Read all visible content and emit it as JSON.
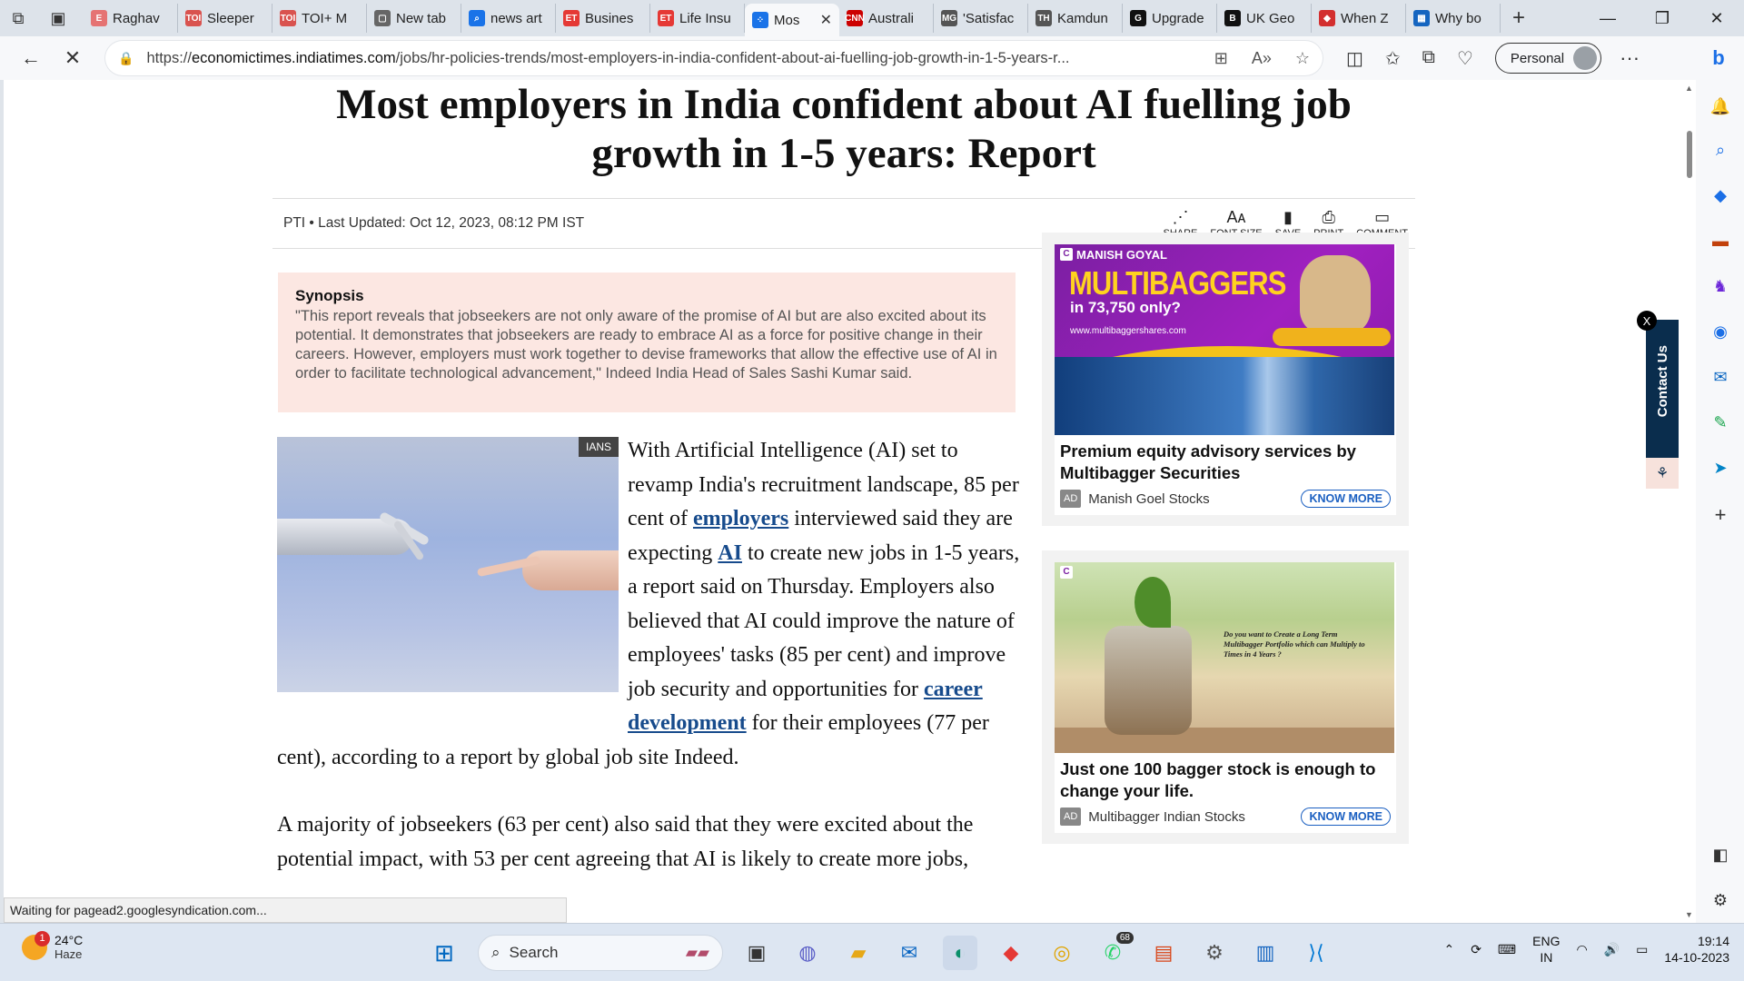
{
  "browser": {
    "tabs": [
      {
        "label": "Raghav",
        "favicon_color": "#e57373",
        "favicon_text": "E"
      },
      {
        "label": "Sleeper",
        "favicon_color": "#d9534f",
        "favicon_text": "TOI"
      },
      {
        "label": "TOI+ M",
        "favicon_color": "#d9534f",
        "favicon_text": "TOI"
      },
      {
        "label": "New tab",
        "favicon_color": "#666",
        "favicon_text": "▢"
      },
      {
        "label": "news art",
        "favicon_color": "#1a73e8",
        "favicon_text": "⌕"
      },
      {
        "label": "Busines",
        "favicon_color": "#e53935",
        "favicon_text": "ET"
      },
      {
        "label": "Life Insu",
        "favicon_color": "#e53935",
        "favicon_text": "ET"
      },
      {
        "label": "Mos",
        "favicon_color": "#1a73e8",
        "favicon_text": "⁘",
        "active": true
      },
      {
        "label": "Australi",
        "favicon_color": "#cc0000",
        "favicon_text": "CNN"
      },
      {
        "label": "'Satisfac",
        "favicon_color": "#555",
        "favicon_text": "MG"
      },
      {
        "label": "Kamdun",
        "favicon_color": "#555",
        "favicon_text": "TH"
      },
      {
        "label": "Upgrade",
        "favicon_color": "#111",
        "favicon_text": "G"
      },
      {
        "label": "UK Geo",
        "favicon_color": "#111",
        "favicon_text": "B"
      },
      {
        "label": "When Z",
        "favicon_color": "#d32f2f",
        "favicon_text": "◆"
      },
      {
        "label": "Why bo",
        "favicon_color": "#1565c0",
        "favicon_text": "▦"
      }
    ],
    "url_prefix": "https://",
    "url_domain": "economictimes.indiatimes.com",
    "url_path": "/jobs/hr-policies-trends/most-employers-in-india-confident-about-ai-fuelling-job-growth-in-1-5-years-r...",
    "profile_label": "Personal",
    "status_text": "Waiting for pagead2.googlesyndication.com..."
  },
  "article": {
    "headline": "Most employers in India confident about AI fuelling job growth in 1-5 years: Report",
    "byline_source": "PTI",
    "byline_updated": "Last Updated: Oct 12, 2023, 08:12 PM IST",
    "actions": [
      {
        "label": "SHARE",
        "icon": "share-icon"
      },
      {
        "label": "FONT SIZE",
        "icon": "font-size-icon"
      },
      {
        "label": "SAVE",
        "icon": "bookmark-icon"
      },
      {
        "label": "PRINT",
        "icon": "print-icon"
      },
      {
        "label": "COMMENT",
        "icon": "comment-icon"
      }
    ],
    "synopsis_title": "Synopsis",
    "synopsis_text": "\"This report reveals that jobseekers are not only aware of the promise of AI but are also excited about its potential. It demonstrates that jobseekers are ready to embrace AI as a force for positive change in their careers. However, employers must work together to devise frameworks that allow the effective use of AI in order to facilitate technological advancement,\" Indeed India Head of Sales Sashi Kumar said.",
    "image_credit": "IANS",
    "p1": {
      "t1": "With Artificial Intelligence (AI) set to revamp India's recruitment landscape, 85 per cent of ",
      "link1": "employers",
      "t2": " interviewed said they are expecting ",
      "link2": "AI",
      "t3": " to create new jobs in 1-5 years, a report said on Thursday. Employers also believed that AI could improve the nature of employees' tasks (85 per cent) and improve job security and opportunities for ",
      "link3": "career development",
      "t4": " for their employees (77 per cent), according to a report by global job site Indeed."
    },
    "p2": "A majority of jobseekers (63 per cent) also said that they were excited about the potential impact, with 53 per cent agreeing that AI is likely to create more jobs,"
  },
  "ads": [
    {
      "brand": "MANISH GOYAL",
      "headline_big": "MULTIBAGGERS",
      "headline_sub": "in 73,750 only?",
      "site": "www.multibaggershares.com",
      "title": "Premium equity advisory services by Multibagger Securities",
      "advertiser": "Manish Goel Stocks",
      "badge": "AD",
      "cta": "KNOW MORE"
    },
    {
      "image_copy": "Do you want to Create a Long Term Multibagger Portfolio which can Multiply to Times in 4 Years ?",
      "title": "Just one 100 bagger stock is enough to change your life.",
      "advertiser": "Multibagger Indian Stocks",
      "badge": "AD",
      "cta": "KNOW MORE"
    }
  ],
  "contact": {
    "label": "Contact Us",
    "close": "X"
  },
  "taskbar": {
    "weather_temp": "24°C",
    "weather_desc": "Haze",
    "weather_badge": "1",
    "search_label": "Search",
    "whatsapp_badge": "68",
    "lang_top": "ENG",
    "lang_bottom": "IN",
    "time": "19:14",
    "date": "14-10-2023"
  }
}
